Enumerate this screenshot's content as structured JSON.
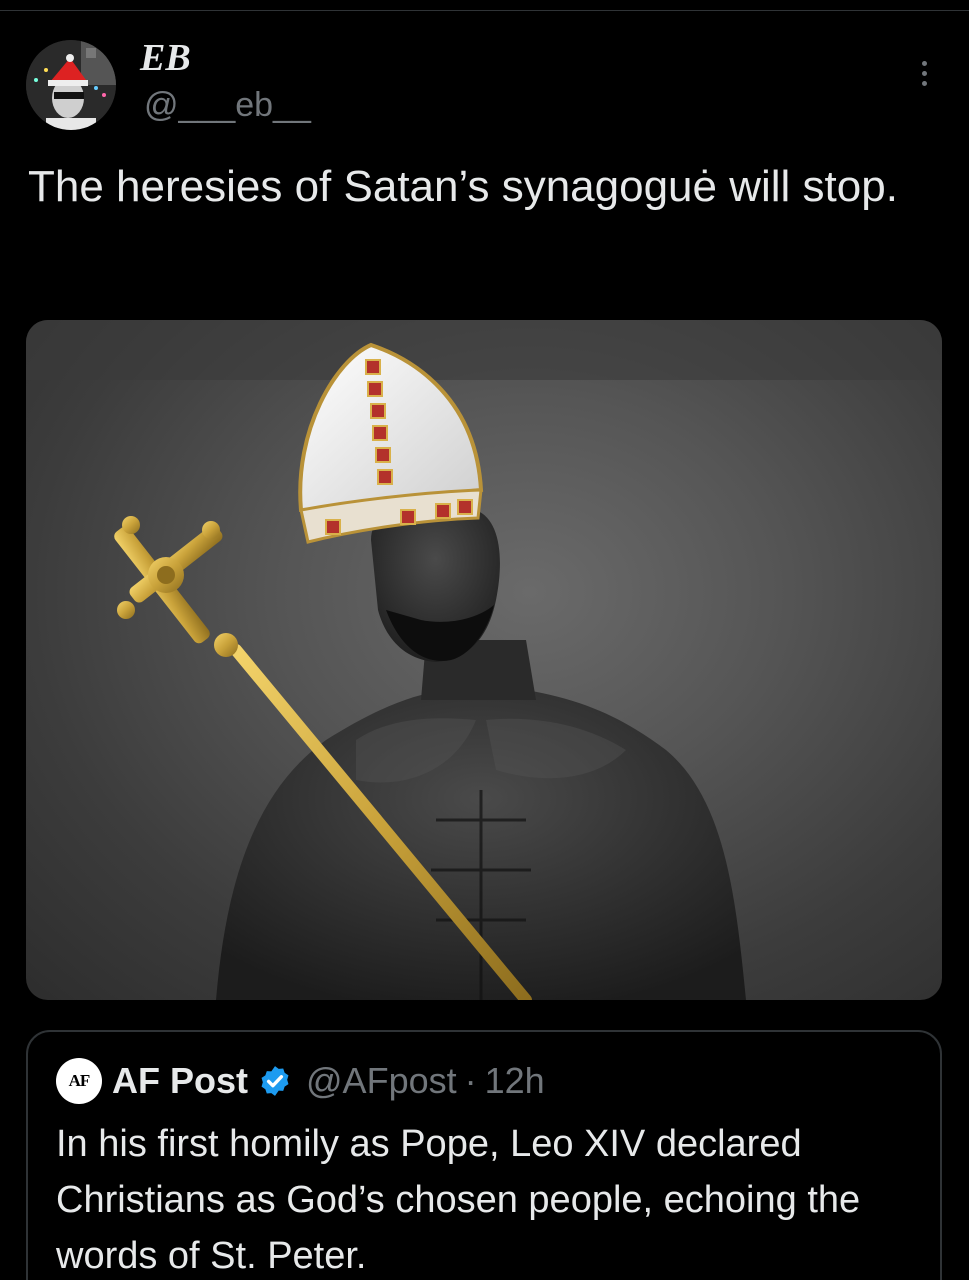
{
  "tweet": {
    "display_name": "EB",
    "handle": "@___eb__",
    "text": "The heresies of Satan’s synagoguė will stop."
  },
  "quoted_tweet": {
    "logo_text": "AF",
    "name": "AF Post",
    "handle": "@AFpost",
    "separator": "·",
    "time": "12h",
    "text": "In his first homily as Pope, Leo XIV declared Christians as God’s chosen people, echoing the words of St. Peter."
  },
  "icons": {
    "more": "more-vertical-icon",
    "verified": "verified-badge-icon"
  },
  "colors": {
    "background": "#000000",
    "text": "#e7e9ea",
    "secondary": "#71767b",
    "border": "#2f3336",
    "verified": "#1d9bf0"
  }
}
